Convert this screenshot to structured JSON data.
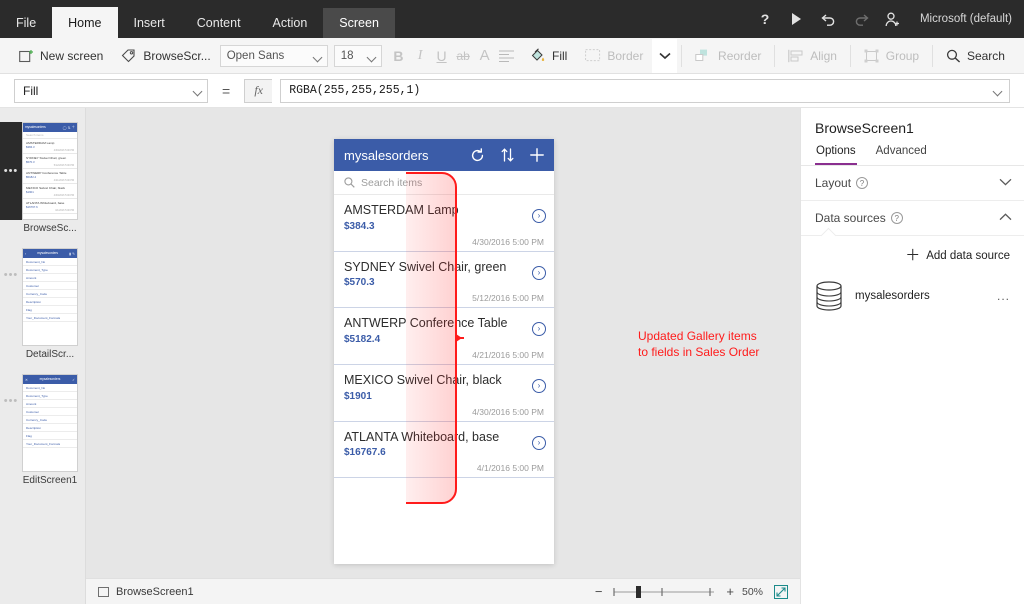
{
  "menubar": {
    "tabs": [
      {
        "label": "File",
        "state": "normal"
      },
      {
        "label": "Home",
        "state": "active"
      },
      {
        "label": "Insert",
        "state": "normal"
      },
      {
        "label": "Content",
        "state": "normal"
      },
      {
        "label": "Action",
        "state": "normal"
      },
      {
        "label": "Screen",
        "state": "context"
      }
    ],
    "help_icon": "?",
    "play_icon": "play-icon",
    "undo_icon": "undo-icon",
    "redo_icon": "redo-icon",
    "share_icon": "add-user-icon",
    "account": "Microsoft (default)"
  },
  "ribbon": {
    "new_screen": "New screen",
    "screen_name": "BrowseScr...",
    "font_family": "Open Sans",
    "font_size": "18",
    "bold": "B",
    "italic": "I",
    "underline": "U",
    "strike": "ab",
    "text_color": "A",
    "align": "align-icon",
    "fill": "Fill",
    "border": "Border",
    "more": "chevron-down-icon",
    "reorder": "Reorder",
    "align_label": "Align",
    "group": "Group",
    "search": "Search"
  },
  "formulabar": {
    "property": "Fill",
    "equals": "=",
    "fx": "fx",
    "formula": "RGBA(255,255,255,1)"
  },
  "rail": {
    "screens": [
      {
        "label": "BrowseSc...",
        "selected": true,
        "type": "gallery",
        "header": "mysalesorders",
        "search": "Search items",
        "items": [
          {
            "name": "AMSTERDAM Lamp",
            "price": "$384.3",
            "date": "4/30/2016 5:00 PM"
          },
          {
            "name": "SYDNEY Swivel Chair, green",
            "price": "$570.3",
            "date": "5/12/2016 5:00 PM"
          },
          {
            "name": "ANTWERP Conference Table",
            "price": "$5182.4",
            "date": "4/21/2016 5:00 PM"
          },
          {
            "name": "MEXICO Swivel Chair, black",
            "price": "$1901",
            "date": "4/30/2016 5:00 PM"
          },
          {
            "name": "ATLANTA Whiteboard, base",
            "price": "$16767.6",
            "date": "4/1/2016 5:00 PM"
          }
        ]
      },
      {
        "label": "DetailScr...",
        "selected": false,
        "type": "form",
        "header": "mysalesorders",
        "fields": [
          "Document_No",
          "Document_Type",
          "Amount",
          "Customer",
          "Currency_Code",
          "Description",
          "Flag",
          "Your_Document_Formats"
        ]
      },
      {
        "label": "EditScreen1",
        "selected": false,
        "type": "form",
        "header": "mysalesorders",
        "fields": [
          "Document_No",
          "Document_Type",
          "Amount",
          "Customer",
          "Currency_Code",
          "Description",
          "Flag",
          "Your_Document_Formats"
        ]
      }
    ]
  },
  "app": {
    "header": {
      "title": "mysalesorders",
      "refresh_icon": "refresh-icon",
      "sort_icon": "sort-icon",
      "add_icon": "plus-icon"
    },
    "search_placeholder": "Search items",
    "search_icon": "search-icon",
    "gallery": [
      {
        "name": "AMSTERDAM Lamp",
        "price": "$384.3",
        "date": "4/30/2016 5:00 PM"
      },
      {
        "name": "SYDNEY Swivel Chair, green",
        "price": "$570.3",
        "date": "5/12/2016 5:00 PM"
      },
      {
        "name": "ANTWERP Conference Table",
        "price": "$5182.4",
        "date": "4/21/2016 5:00 PM"
      },
      {
        "name": "MEXICO Swivel Chair, black",
        "price": "$1901",
        "date": "4/30/2016 5:00 PM"
      },
      {
        "name": "ATLANTA Whiteboard, base",
        "price": "$16767.6",
        "date": "4/1/2016 5:00 PM"
      }
    ]
  },
  "annotation": {
    "line1": "Updated Gallery items",
    "line2": "to fields in Sales Order",
    "color": "#ff1b1b"
  },
  "rightpanel": {
    "title": "BrowseScreen1",
    "tabs": [
      {
        "label": "Options",
        "active": true
      },
      {
        "label": "Advanced",
        "active": false
      }
    ],
    "sections": [
      {
        "label": "Layout",
        "expanded": false,
        "chevron": "chevron-down-icon"
      },
      {
        "label": "Data sources",
        "expanded": true,
        "chevron": "chevron-up-icon"
      }
    ],
    "add_data_source": "Add data source",
    "data_sources": [
      {
        "name": "mysalesorders",
        "icon": "database-icon",
        "more": "..."
      }
    ]
  },
  "statusbar": {
    "screen_name": "BrowseScreen1",
    "zoom_out": "−",
    "zoom_in": "+",
    "zoom_level": "50%",
    "fullscreen_icon": "fullscreen-icon"
  },
  "colors": {
    "app_header_blue": "#3b5ca8",
    "accent_purple": "#8a2f8f",
    "annotation_red": "#ff1b1b",
    "chrome_dark": "#2b2b2b"
  }
}
